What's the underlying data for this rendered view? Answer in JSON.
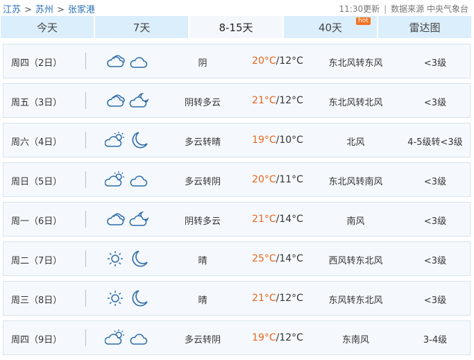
{
  "breadcrumb": [
    "江苏",
    "苏州",
    "张家港"
  ],
  "breadcrumb_sep": ">",
  "meta": {
    "updated": "11:30更新",
    "source": "数据来源 中央气象台"
  },
  "tabs": [
    {
      "label": "今天"
    },
    {
      "label": "7天"
    },
    {
      "label": "8-15天",
      "active": true
    },
    {
      "label": "40天",
      "badge": "hot"
    },
    {
      "label": "雷达图"
    }
  ],
  "forecast": [
    {
      "day": "周四（2日）",
      "icon_day": "cloudy-icon",
      "icon_night": "cloudy-night-icon",
      "weather": "阴",
      "high": "20°C",
      "low": "/12°C",
      "wind": "东北风转东风",
      "level": "<3级"
    },
    {
      "day": "周五（3日）",
      "icon_day": "cloudy-icon",
      "icon_night": "partly-cloudy-night-icon",
      "weather": "阴转多云",
      "high": "21°C",
      "low": "/12°C",
      "wind": "东北风转北风",
      "level": "<3级"
    },
    {
      "day": "周六（4日）",
      "icon_day": "partly-cloudy-icon",
      "icon_night": "moon-icon",
      "weather": "多云转晴",
      "high": "19°C",
      "low": "/10°C",
      "wind": "北风",
      "level": "4-5级转<3级"
    },
    {
      "day": "周日（5日）",
      "icon_day": "partly-cloudy-icon",
      "icon_night": "cloudy-night-icon",
      "weather": "多云转阴",
      "high": "20°C",
      "low": "/11°C",
      "wind": "东北风转南风",
      "level": "<3级"
    },
    {
      "day": "周一（6日）",
      "icon_day": "cloudy-icon",
      "icon_night": "partly-cloudy-night-icon",
      "weather": "阴转多云",
      "high": "21°C",
      "low": "/14°C",
      "wind": "南风",
      "level": "<3级"
    },
    {
      "day": "周二（7日）",
      "icon_day": "sun-icon",
      "icon_night": "moon-icon",
      "weather": "晴",
      "high": "25°C",
      "low": "/14°C",
      "wind": "西风转东北风",
      "level": "<3级"
    },
    {
      "day": "周三（8日）",
      "icon_day": "sun-icon",
      "icon_night": "moon-icon",
      "weather": "晴",
      "high": "21°C",
      "low": "/12°C",
      "wind": "东风转东北风",
      "level": "<3级"
    },
    {
      "day": "周四（9日）",
      "icon_day": "partly-cloudy-icon",
      "icon_night": "cloudy-night-icon",
      "weather": "多云转阴",
      "high": "19°C",
      "low": "/12°C",
      "wind": "东南风",
      "level": "3-4级"
    }
  ],
  "colors": {
    "tab_bg": "#dbeefb",
    "tab_active_bg": "#f4f8fc",
    "high_temp": "#e8651a",
    "link": "#2a6fb5",
    "icon_stroke": "#2b6aa8",
    "hot_badge": "#f07422"
  }
}
